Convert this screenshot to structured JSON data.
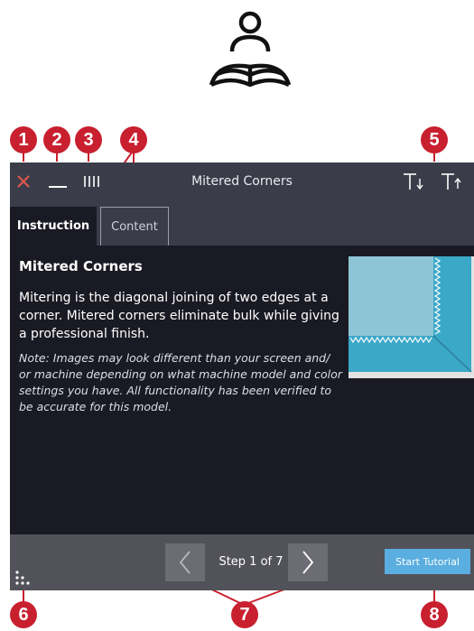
{
  "icons": {
    "tutorial": "person-reading-book-icon",
    "close": "close-icon",
    "minimize": "minimize-icon",
    "columns": "vertical-bars-icon",
    "text_smaller": "text-size-decrease-icon",
    "text_larger": "text-size-increase-icon",
    "menu": "dots-menu-icon",
    "prev": "chevron-left-icon",
    "next": "chevron-right-icon"
  },
  "colors": {
    "badge": "#c8202f",
    "close": "#e2574c",
    "window_bg": "#1a1a24",
    "titlebar_bg": "#3a3d49",
    "accent": "#5aaee0"
  },
  "callouts": [
    "1",
    "2",
    "3",
    "4",
    "5",
    "6",
    "7",
    "8"
  ],
  "window": {
    "title": "Mitered Corners"
  },
  "tabs": [
    {
      "label": "Instruction",
      "active": true
    },
    {
      "label": "Content",
      "active": false
    }
  ],
  "content": {
    "heading": "Mitered Corners",
    "paragraph": "Mitering is the diagonal joining of two edges at a corner. Mitered corners eliminate bulk while giving a professional finish.",
    "note": "Note: Images may look different than your screen and/ or machine depending on what machine model and color settings you have. All functionality has been verified to be accurate for this model."
  },
  "footer": {
    "step_text": "Step 1 of 7",
    "start_button": "Start Tutorial"
  }
}
